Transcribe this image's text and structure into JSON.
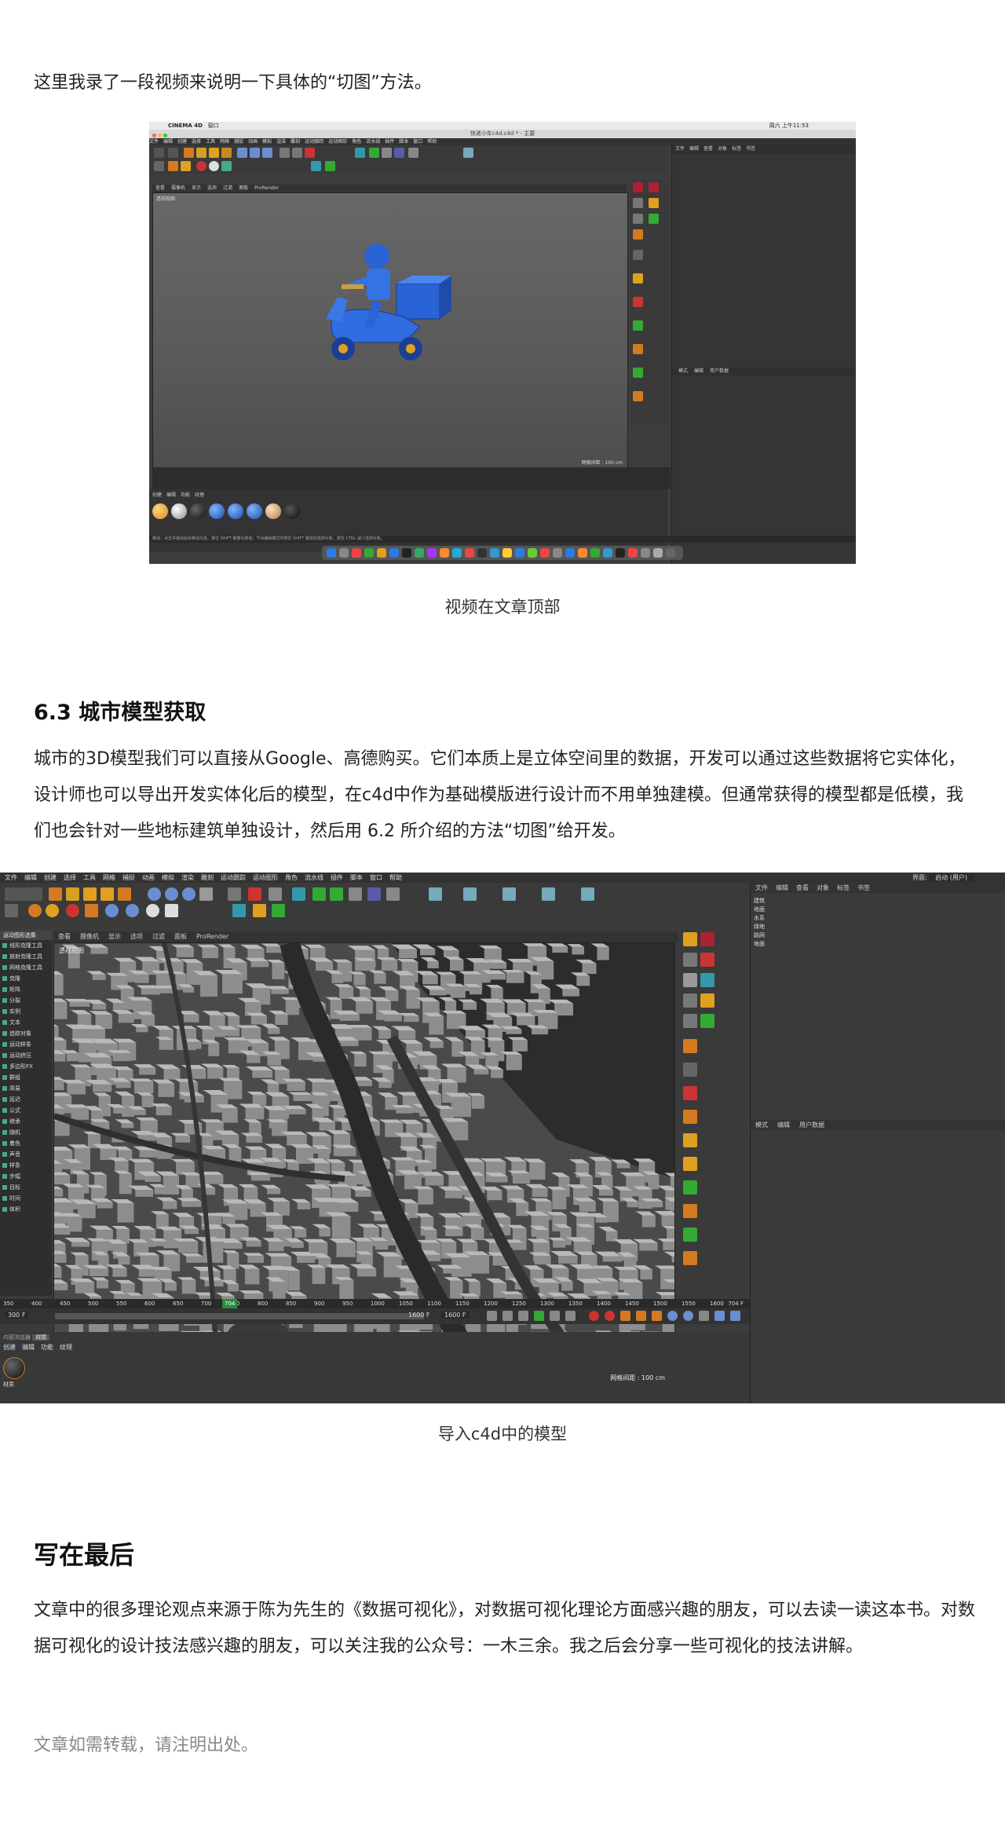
{
  "intro_text": "这里我录了一段视频来说明一下具体的“切图”方法。",
  "caption1": "视频在文章顶部",
  "shot1": {
    "app": "CINEMA 4D",
    "window_menu": "窗口",
    "file_title": "快递小车c4d.c4d * - 主要",
    "clock": "周六 上午11:53",
    "menu": [
      "文件",
      "编辑",
      "创建",
      "选择",
      "工具",
      "网格",
      "捕捉",
      "动画",
      "模拟",
      "渲染",
      "雕刻",
      "运动跟踪",
      "运动图形",
      "角色",
      "流水线",
      "插件",
      "脚本",
      "窗口",
      "帮助"
    ],
    "view_tabs": [
      "查看",
      "摄像机",
      "显示",
      "选项",
      "过滤",
      "面板",
      "ProRender"
    ],
    "view_label": "透视视图",
    "grid_label": "网格间距 : 100 cm",
    "panel_tabs": [
      "文件",
      "编辑",
      "查看",
      "对象",
      "标签",
      "书签"
    ],
    "attr_tabs": [
      "模式",
      "编辑",
      "用户数据"
    ],
    "material_tabs": [
      "创建",
      "编辑",
      "功能",
      "纹理"
    ],
    "status": "移动：点击并拖动鼠标移动元素。按住 SHIFT 键量化移动；节点编辑模式时按住 SHIFT 键增加选择对象；按住 CTRL 减少选择对象。"
  },
  "section_title": "6.3 城市模型获取",
  "section_body": "城市的3D模型我们可以直接从Google、高德购买。它们本质上是立体空间里的数据，开发可以通过这些数据将它实体化，设计师也可以导出开发实体化后的模型，在c4d中作为基础模版进行设计而不用单独建模。但通常获得的模型都是低模，我们也会针对一些地标建筑单独设计，然后用 6.2 所介绍的方法“切图”给开发。",
  "shot2": {
    "menu": [
      "文件",
      "编辑",
      "创建",
      "选择",
      "工具",
      "网格",
      "捕捉",
      "动画",
      "模拟",
      "渲染",
      "雕刻",
      "运动跟踪",
      "运动图形",
      "角色",
      "流水线",
      "插件",
      "脚本",
      "窗口",
      "帮助"
    ],
    "interface_label": "界面:",
    "interface_value": "启动 (用户)",
    "left_panel_title": "运动图形选集",
    "left_items": [
      "线形克隆工具",
      "放射克隆工具",
      "网格克隆工具",
      "克隆",
      "矩阵",
      "分裂",
      "实例",
      "文本",
      "追踪对象",
      "运动样条",
      "运动挤压",
      "多边形FX",
      "群组",
      "简易",
      "延迟",
      "公式",
      "继承",
      "随机",
      "着色",
      "声音",
      "样条",
      "步幅",
      "目标",
      "时间",
      "体积"
    ],
    "view_tabs": [
      "查看",
      "摄像机",
      "显示",
      "选项",
      "过滤",
      "面板",
      "ProRender"
    ],
    "view_label": "透视视图",
    "grid_label": "网格间距 : 100 cm",
    "panel_tabs": [
      "文件",
      "编辑",
      "查看",
      "对象",
      "标签",
      "书签"
    ],
    "objects": [
      "建筑",
      "地面",
      "水系",
      "绿地",
      "路网",
      "地面"
    ],
    "attr_tabs": [
      "模式",
      "编辑",
      "用户数据"
    ],
    "ruler": [
      "350",
      "400",
      "450",
      "500",
      "550",
      "600",
      "650",
      "700",
      "750",
      "800",
      "850",
      "900",
      "950",
      "1000",
      "1050",
      "1100",
      "1150",
      "1200",
      "1250",
      "1300",
      "1350",
      "1400",
      "1450",
      "1500",
      "1550",
      "1600"
    ],
    "frame_current": "704",
    "frame_end_label": "704 F",
    "frame_start": "300 F",
    "frame_max": "1600 F",
    "frame_max2": "1600 F",
    "material_panel_title": "内容浏览器",
    "material_tab": "材质",
    "material_tabs": [
      "创建",
      "编辑",
      "功能",
      "纹理"
    ],
    "material_name": "材质"
  },
  "caption2": "导入c4d中的模型",
  "final_title": "写在最后",
  "final_body": "文章中的很多理论观点来源于陈为先生的《数据可视化》，对数据可视化理论方面感兴趣的朋友，可以去读一读这本书。对数据可视化的设计技法感兴趣的朋友，可以关注我的公众号：一木三余。我之后会分享一些可视化的技法讲解。",
  "repost_note": "文章如需转载，请注明出处。"
}
